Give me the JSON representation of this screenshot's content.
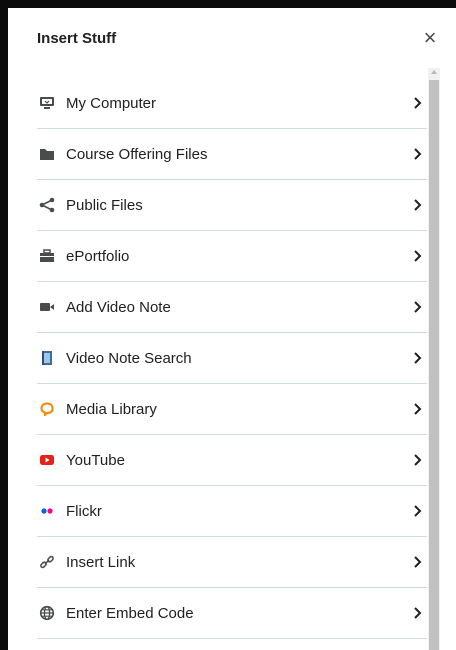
{
  "dialog": {
    "title": "Insert Stuff",
    "close_label": "×"
  },
  "items": [
    {
      "label": "My Computer",
      "icon": "computer-icon"
    },
    {
      "label": "Course Offering Files",
      "icon": "folder-icon"
    },
    {
      "label": "Public Files",
      "icon": "share-icon"
    },
    {
      "label": "ePortfolio",
      "icon": "briefcase-icon"
    },
    {
      "label": "Add Video Note",
      "icon": "video-camera-icon"
    },
    {
      "label": "Video Note Search",
      "icon": "video-note-search-icon"
    },
    {
      "label": "Media Library",
      "icon": "media-library-icon"
    },
    {
      "label": "YouTube",
      "icon": "youtube-icon"
    },
    {
      "label": "Flickr",
      "icon": "flickr-icon"
    },
    {
      "label": "Insert Link",
      "icon": "link-icon"
    },
    {
      "label": "Enter Embed Code",
      "icon": "globe-icon"
    }
  ],
  "colors": {
    "youtube": "#e62117",
    "flickr_blue": "#0063dc",
    "flickr_pink": "#ff0084",
    "media_library": "#f29111",
    "divider": "#d3d9e3"
  }
}
